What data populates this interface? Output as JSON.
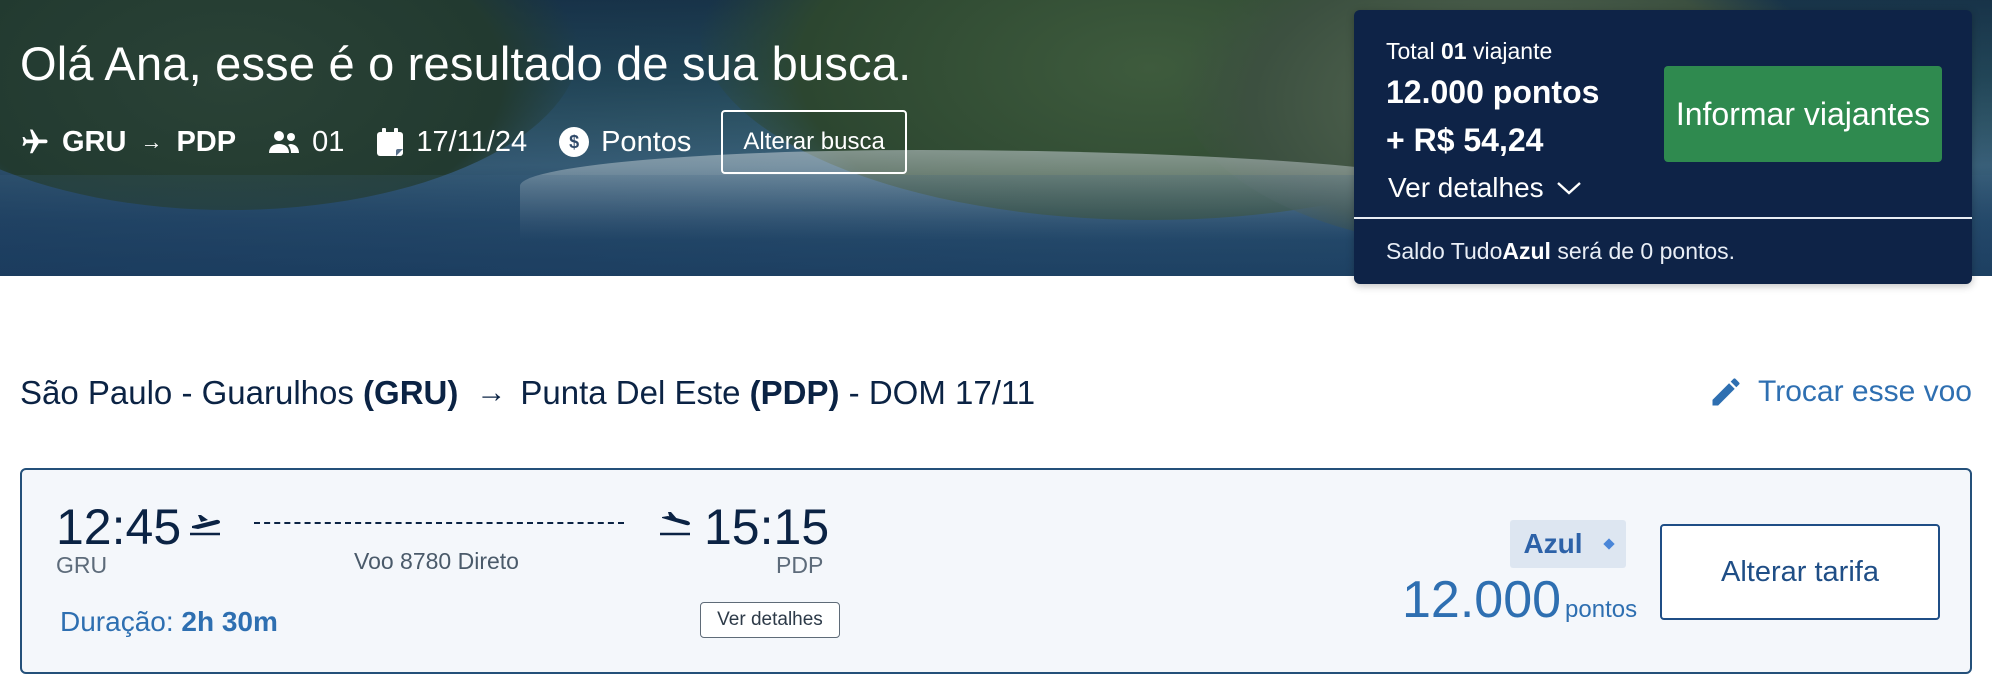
{
  "hero": {
    "title": "Olá Ana, esse é o resultado de sua busca.",
    "origin": "GRU",
    "destination": "PDP",
    "passengers": "01",
    "date": "17/11/24",
    "payment": "Pontos",
    "alter_button": "Alterar busca"
  },
  "summary": {
    "total_label": "Total",
    "total_count": "01",
    "total_suffix": "viajante",
    "points": "12.000 pontos",
    "money": "+ R$ 54,24",
    "details_label": "Ver detalhes",
    "inform_button": "Informar viajantes",
    "saldo_prefix": "Saldo Tudo",
    "saldo_brand": "Azul",
    "saldo_suffix": " será de 0 pontos."
  },
  "route": {
    "origin_city": "São Paulo - Guarulhos",
    "origin_code": "(GRU)",
    "dest_city": "Punta Del Este",
    "dest_code": "(PDP)",
    "date_label": "- DOM 17/11",
    "change_flight": "Trocar esse voo"
  },
  "flight": {
    "departure_time": "12:45",
    "departure_code": "GRU",
    "arrival_time": "15:15",
    "arrival_code": "PDP",
    "flight_info": "Voo 8780 Direto",
    "duration_label": "Duração:",
    "duration_value": "2h 30m",
    "details_button": "Ver detalhes",
    "fare_name": "Azul",
    "price_value": "12.000",
    "price_unit": "pontos",
    "alter_fare_button": "Alterar tarifa"
  },
  "colors": {
    "navy": "#0e2347",
    "green": "#2f8a4f",
    "link_blue": "#2e6fb1",
    "card_border": "#24507a"
  },
  "icons": [
    "airplane-icon",
    "arrow-right-icon",
    "users-icon",
    "calendar-icon",
    "coin-icon",
    "chevron-down-icon",
    "pencil-icon",
    "takeoff-icon",
    "landing-icon",
    "diamond-icon"
  ]
}
